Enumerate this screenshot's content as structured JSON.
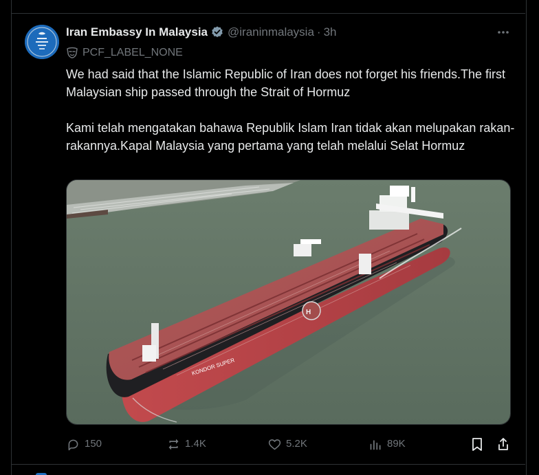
{
  "post": {
    "display_name": "Iran Embassy In Malaysia",
    "handle": "@iraninmalaysia",
    "separator": "·",
    "time": "3h",
    "label": "PCF_LABEL_NONE",
    "text_en": "We had said that the Islamic Republic of Iran does not forget his friends.The first Malaysian ship passed through the Strait of Hormuz",
    "text_ms": "Kami telah mengatakan bahawa Republik Islam Iran tidak akan melupakan rakan-rakannya.Kapal Malaysia yang pertama yang telah melalui Selat Hormuz"
  },
  "media": {
    "description_icon": "ship-photo",
    "hull_text": "KONDOR SUPER"
  },
  "actions": {
    "replies": "150",
    "reposts": "1.4K",
    "likes": "5.2K",
    "views": "89K"
  },
  "icons": {
    "verified": "verified-badge-icon",
    "more": "more-icon",
    "label": "mask-icon",
    "reply": "reply-icon",
    "repost": "repost-icon",
    "like": "heart-icon",
    "views": "views-icon",
    "bookmark": "bookmark-icon",
    "share": "share-icon"
  },
  "colors": {
    "background": "#000000",
    "text": "#e7e9ea",
    "muted": "#71767b",
    "border": "#2f3336",
    "verified": "#829aab",
    "accent": "#1d9bf0"
  }
}
